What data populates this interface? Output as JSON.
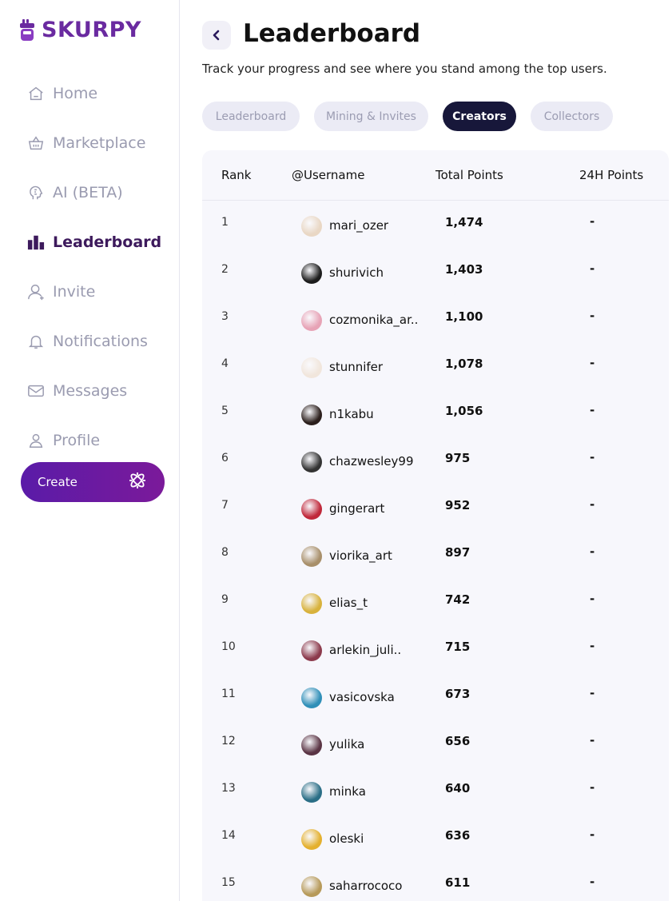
{
  "app": {
    "brand": "SKURPY"
  },
  "sidebar": {
    "items": [
      {
        "label": "Home",
        "icon": "home-icon"
      },
      {
        "label": "Marketplace",
        "icon": "basket-icon"
      },
      {
        "label": "AI (BETA)",
        "icon": "ai-head-icon"
      },
      {
        "label": "Leaderboard",
        "icon": "bar-chart-icon"
      },
      {
        "label": "Invite",
        "icon": "add-user-icon"
      },
      {
        "label": "Notifications",
        "icon": "bell-icon"
      },
      {
        "label": "Messages",
        "icon": "mail-icon"
      },
      {
        "label": "Profile",
        "icon": "user-icon"
      }
    ],
    "active": "Leaderboard",
    "create_label": "Create"
  },
  "header": {
    "title": "Leaderboard",
    "subtitle": "Track your progress and see where you stand among the top users."
  },
  "tabs": [
    {
      "label": "Leaderboard"
    },
    {
      "label": "Mining & Invites"
    },
    {
      "label": "Creators"
    },
    {
      "label": "Collectors"
    }
  ],
  "active_tab": "Creators",
  "table": {
    "headers": {
      "rank": "Rank",
      "username": "@Username",
      "total": "Total Points",
      "h24": "24H Points"
    },
    "rows": [
      {
        "rank": "1",
        "username": "mari_ozer",
        "total": "1,474",
        "h24": "-",
        "avatar_color": "#e9d7c4"
      },
      {
        "rank": "2",
        "username": "shurivich",
        "total": "1,403",
        "h24": "-",
        "avatar_color": "#1c1c1c"
      },
      {
        "rank": "3",
        "username": "cozmonika_ar..",
        "total": "1,100",
        "h24": "-",
        "avatar_color": "#e7a3b6"
      },
      {
        "rank": "4",
        "username": "stunnifer",
        "total": "1,078",
        "h24": "-",
        "avatar_color": "#f1e6dc"
      },
      {
        "rank": "5",
        "username": "n1kabu",
        "total": "1,056",
        "h24": "-",
        "avatar_color": "#2b1f1c"
      },
      {
        "rank": "6",
        "username": "chazwesley99",
        "total": "975",
        "h24": "-",
        "avatar_color": "#333333"
      },
      {
        "rank": "7",
        "username": "gingerart",
        "total": "952",
        "h24": "-",
        "avatar_color": "#c0283a"
      },
      {
        "rank": "8",
        "username": "viorika_art",
        "total": "897",
        "h24": "-",
        "avatar_color": "#a88f6a"
      },
      {
        "rank": "9",
        "username": "elias_t",
        "total": "742",
        "h24": "-",
        "avatar_color": "#d8b23c"
      },
      {
        "rank": "10",
        "username": "arlekin_juli..",
        "total": "715",
        "h24": "-",
        "avatar_color": "#8c3a4c"
      },
      {
        "rank": "11",
        "username": "vasicovska",
        "total": "673",
        "h24": "-",
        "avatar_color": "#2f8fb8"
      },
      {
        "rank": "12",
        "username": "yulika",
        "total": "656",
        "h24": "-",
        "avatar_color": "#5a3444"
      },
      {
        "rank": "13",
        "username": "minka",
        "total": "640",
        "h24": "-",
        "avatar_color": "#2a6e86"
      },
      {
        "rank": "14",
        "username": "oleski",
        "total": "636",
        "h24": "-",
        "avatar_color": "#e4b02e"
      },
      {
        "rank": "15",
        "username": "saharrococo",
        "total": "611",
        "h24": "-",
        "avatar_color": "#b79a5a"
      }
    ]
  }
}
